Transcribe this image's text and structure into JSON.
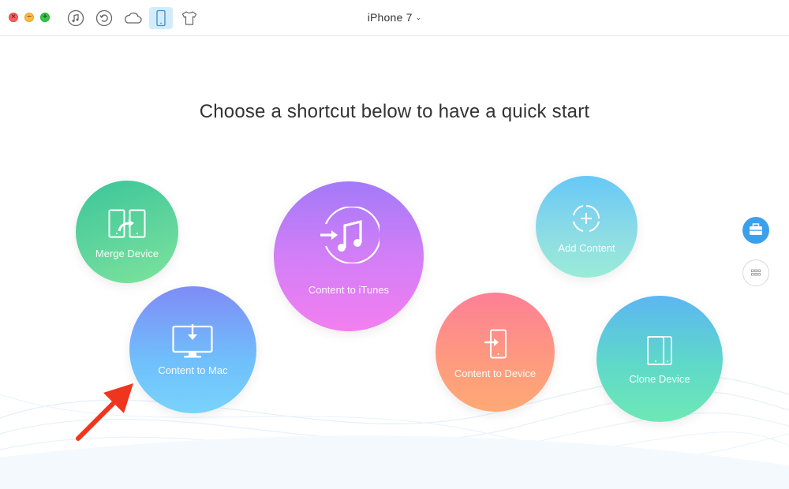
{
  "window": {
    "device_title": "iPhone 7",
    "device_chevron": "⌄"
  },
  "traffic_lights": {
    "close": "×",
    "minimize": "−",
    "maximize": "+"
  },
  "toolbar": {
    "icons": [
      "music-note-icon",
      "restore-icon",
      "cloud-icon",
      "phone-icon",
      "tshirt-icon"
    ],
    "active": "phone-icon"
  },
  "main": {
    "heading": "Choose a shortcut below to have a quick start",
    "shortcuts": {
      "merge_device": "Merge Device",
      "content_to_mac": "Content to Mac",
      "content_to_itunes": "Content to iTunes",
      "add_content": "Add Content",
      "content_to_device": "Content to Device",
      "clone_device": "Clone Device"
    }
  },
  "sidebar": {
    "buttons": [
      "toolkit-icon",
      "apps-grid-icon"
    ]
  },
  "colors": {
    "accent": "#3ba0ec",
    "arrow": "#f0351e",
    "toolbar_active": "#d4ebfb"
  }
}
